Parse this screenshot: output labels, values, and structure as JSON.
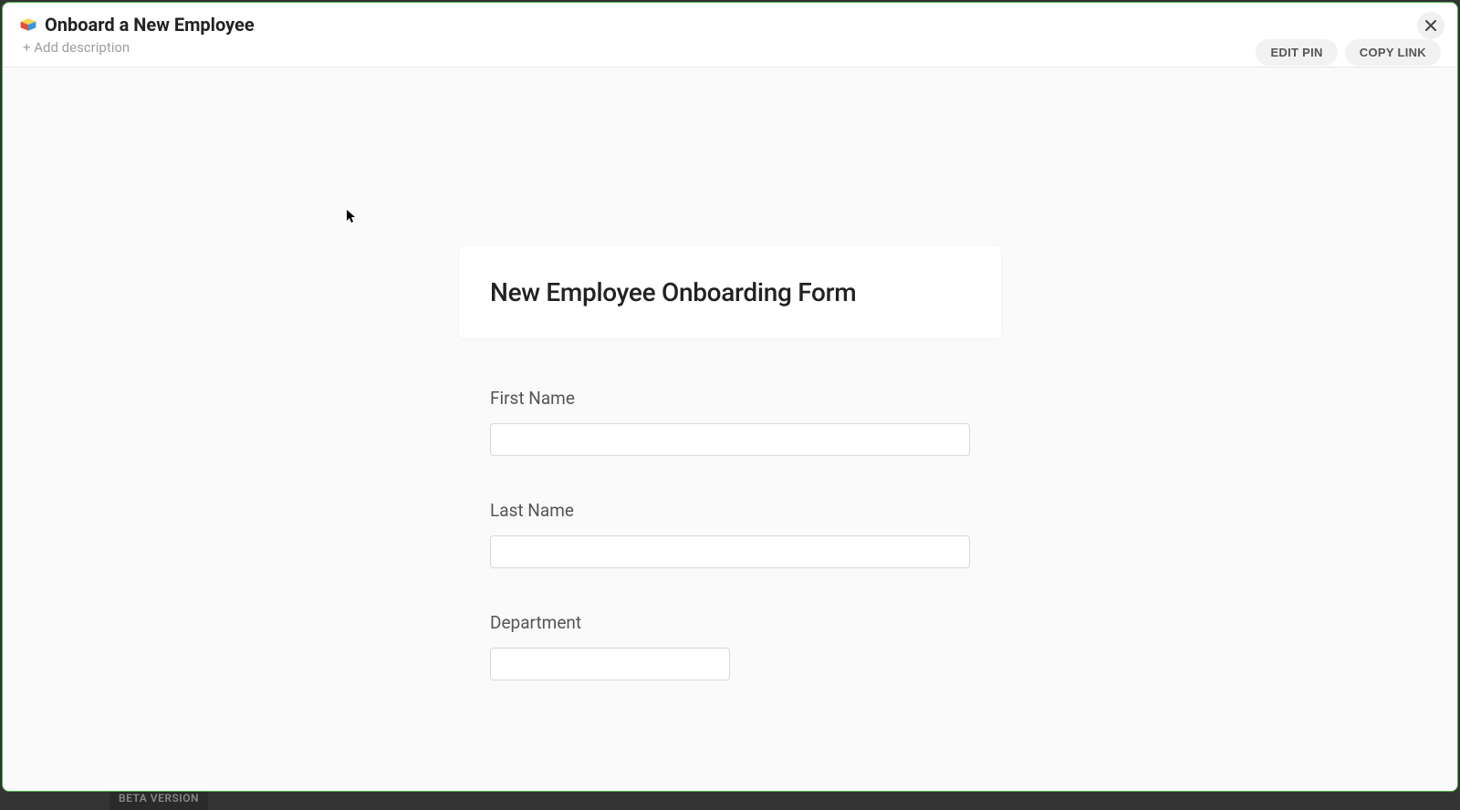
{
  "footer": {
    "beta_label": "BETA VERSION"
  },
  "header": {
    "title": "Onboard a New Employee",
    "add_description": "+ Add description",
    "edit_pin": "EDIT PIN",
    "copy_link": "COPY LINK"
  },
  "form": {
    "title": "New Employee Onboarding Form",
    "fields": [
      {
        "label": "First Name",
        "value": "",
        "width": "full"
      },
      {
        "label": "Last Name",
        "value": "",
        "width": "full"
      },
      {
        "label": "Department",
        "value": "",
        "width": "narrow"
      }
    ]
  }
}
